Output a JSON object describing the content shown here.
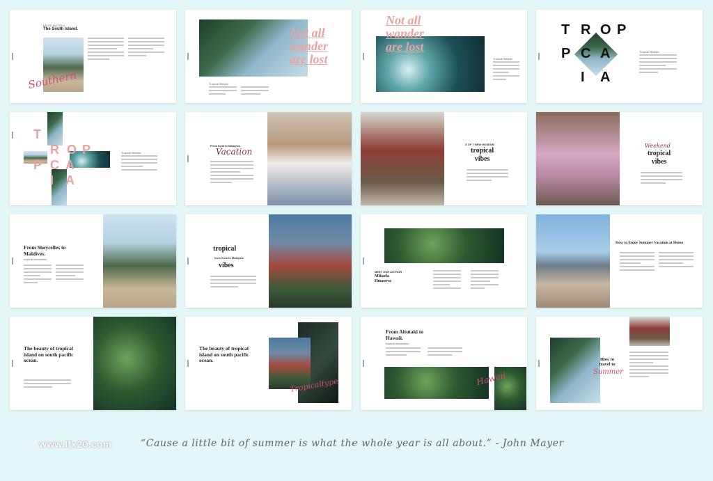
{
  "slides": {
    "s1": {
      "eyebrow": "DESTINATION",
      "title": "The South Island.",
      "script": "Southern"
    },
    "s2": {
      "headline_1": "Not all",
      "headline_2": "wander",
      "headline_3": "are lost",
      "caption": "Tropical lifestyle"
    },
    "s3": {
      "headline_1": "Not all",
      "headline_2": "wander",
      "headline_3": "are lost",
      "caption": "Tropical lifestyle"
    },
    "s4": {
      "letters": [
        "T",
        "R",
        "O",
        "P",
        "P",
        "C",
        "A",
        "I",
        "A"
      ],
      "caption": "Tropical lifestyle"
    },
    "s5": {
      "letters": [
        "T",
        "R",
        "O",
        "P",
        "P",
        "C",
        "A",
        "I",
        "A"
      ],
      "caption": "Tropical lifestyle"
    },
    "s6": {
      "kicker": "From Kuta to Malaysia",
      "script": "Vacation"
    },
    "s7": {
      "kicker": "X OF 7 NEW MUSEUM",
      "title_1": "tropical",
      "title_2": "vibes"
    },
    "s8": {
      "script": "Weekend",
      "title_1": "tropical",
      "title_2": "vibes"
    },
    "s9": {
      "title": "From Sheycelles to Maldives.",
      "kicker": "tropical destination"
    },
    "s10": {
      "title_1": "tropical",
      "kicker": "from Kuta to Malaysia",
      "title_2": "vibes"
    },
    "s11": {
      "kicker": "MEET OUR AUTHOR",
      "name": "Mikaela Hmasova"
    },
    "s12": {
      "title": "How to Enjoy Summer Vacation at Home"
    },
    "s13": {
      "title": "The beauty of tropical island on south pacific ocean."
    },
    "s14": {
      "title": "The beauty of tropical island on south pacific ocean.",
      "script": "Tropicaltype"
    },
    "s15": {
      "title": "From Aitutaki to Hawaii.",
      "kicker": "tropical destination",
      "script": "Hawaii"
    },
    "s16": {
      "title": "How to travel to",
      "script": "Summer"
    }
  },
  "footer": {
    "watermark": "www.lfx20.com",
    "quote": "“Cause a little bit of summer is what the whole year is all about.” - John Mayer"
  }
}
